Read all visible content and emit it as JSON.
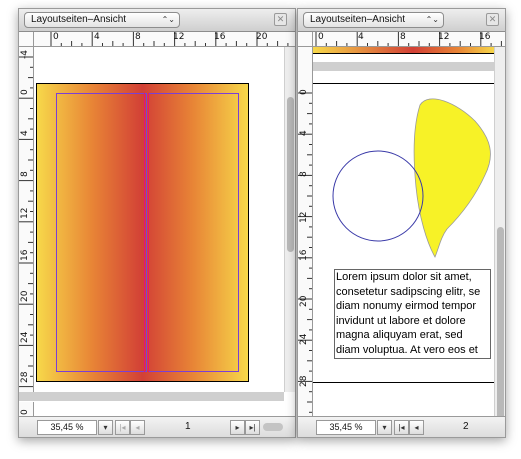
{
  "left_window": {
    "title_popup": "Layoutseiten–Ansicht",
    "ruler_h_labels": [
      "0",
      "4",
      "8",
      "12",
      "16",
      "20",
      "24"
    ],
    "ruler_v_labels": [
      "-4",
      "0",
      "4",
      "8",
      "12",
      "16",
      "20",
      "24",
      "28",
      "0"
    ],
    "zoom": "35,45 %",
    "page_number": "1",
    "gradient": {
      "edge": "#f7d84a",
      "mid": "#e88536",
      "center": "#d24036"
    },
    "guide_color": "#e0127a",
    "margin_color": "#7a3fd6"
  },
  "right_window": {
    "title_popup": "Layoutseiten–Ansicht",
    "ruler_h_labels": [
      "0",
      "4",
      "8",
      "12",
      "16"
    ],
    "ruler_v_labels": [
      "0",
      "4",
      "8",
      "12",
      "16",
      "20",
      "24",
      "28",
      "32"
    ],
    "zoom": "35,45 %",
    "page_number": "2",
    "shape_fill": "#f7f227",
    "circle_stroke": "#3a3aa8",
    "text_lines": [
      "Lorem ipsum dolor sit amet,",
      "consetetur sadipscing elitr, se",
      "diam nonumy eirmod tempor",
      "invidunt ut labore et dolore",
      "magna aliquyam erat, sed",
      "diam voluptua. At vero eos et"
    ]
  }
}
